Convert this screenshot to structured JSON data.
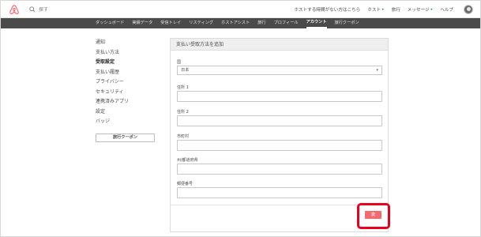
{
  "header": {
    "search_placeholder": "探す",
    "links": [
      {
        "label": "ホストする時間がない方はこちら",
        "dot": false
      },
      {
        "label": "ホスト",
        "dot": true
      },
      {
        "label": "旅行",
        "dot": false
      },
      {
        "label": "メッセージ",
        "dot": true
      },
      {
        "label": "ヘルプ",
        "dot": false
      }
    ],
    "icons": {
      "logo": "airbnb-logo-icon",
      "search": "search-icon",
      "avatar": "user-avatar"
    }
  },
  "nav": {
    "items": [
      "ダッシュボード",
      "実績データ",
      "受信トレイ",
      "リスティング",
      "ホストアシスト",
      "旅行",
      "プロフィール",
      "アカウント",
      "旅行クーポン"
    ],
    "active": "アカウント"
  },
  "sidebar": {
    "items": [
      "通知",
      "支払い方法",
      "受取設定",
      "支払い履歴",
      "プライバシー",
      "セキュリティ",
      "連携済みアプリ",
      "設定",
      "バッジ"
    ],
    "active": "受取設定",
    "coupon_button": "旅行クーポン"
  },
  "form": {
    "title": "支払い受取方法を追加",
    "country_label": "国",
    "country_value": "日本",
    "address1_label": "住所 1",
    "address2_label": "住所 2",
    "city_label": "市町村",
    "prefecture_label": "州/都道府県",
    "postal_label": "郵便番号",
    "next_button": "次"
  },
  "colors": {
    "nav_bg": "#4a4a4a",
    "accent": "#f5686b",
    "highlight": "#e8001c",
    "logo": "#ff5a5f"
  }
}
